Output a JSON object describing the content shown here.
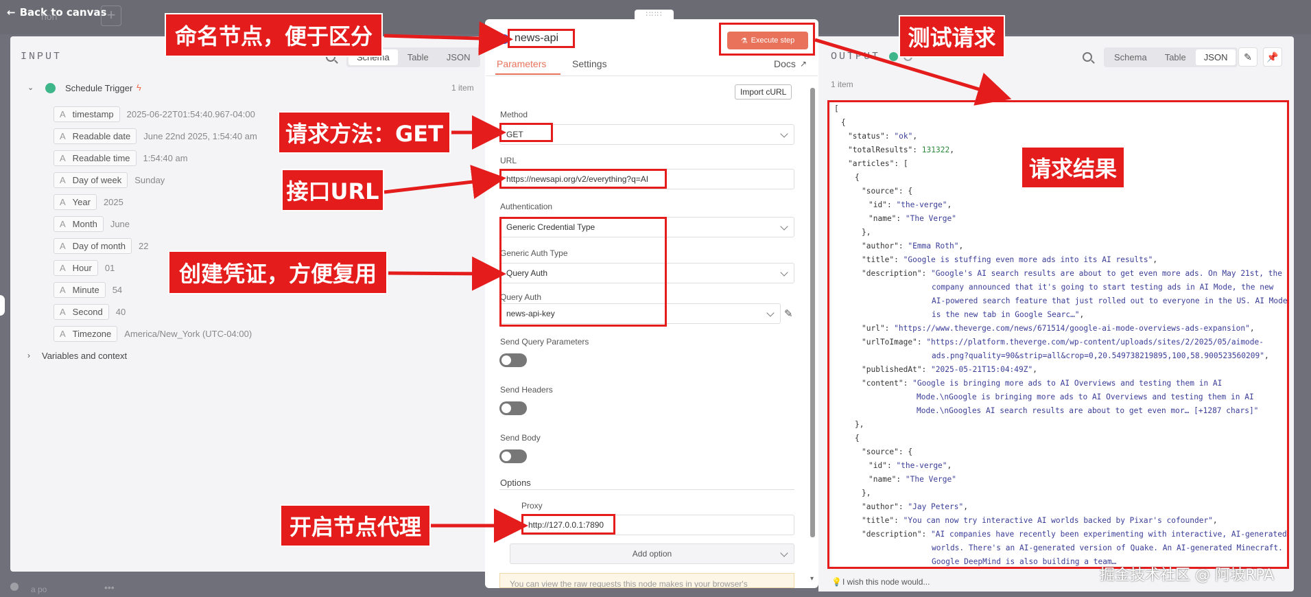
{
  "topbar": {
    "back_label": "Back to canvas",
    "ghost_name": "hon"
  },
  "input": {
    "title": "INPUT",
    "views": [
      "Schema",
      "Table",
      "JSON"
    ],
    "trigger": "Schedule Trigger",
    "count": "1 item",
    "fields": [
      {
        "key": "timestamp",
        "value": "2025-06-22T01:54:40.967-04:00"
      },
      {
        "key": "Readable date",
        "value": "June 22nd 2025, 1:54:40 am"
      },
      {
        "key": "Readable time",
        "value": "1:54:40 am"
      },
      {
        "key": "Day of week",
        "value": "Sunday"
      },
      {
        "key": "Year",
        "value": "2025"
      },
      {
        "key": "Month",
        "value": "June"
      },
      {
        "key": "Day of month",
        "value": "22"
      },
      {
        "key": "Hour",
        "value": "01"
      },
      {
        "key": "Minute",
        "value": "54"
      },
      {
        "key": "Second",
        "value": "40"
      },
      {
        "key": "Timezone",
        "value": "America/New_York (UTC-04:00)"
      }
    ],
    "variables": "Variables and context",
    "footer_node": "a po"
  },
  "node": {
    "name": "news-api",
    "execute": "Execute step",
    "tabs": [
      "Parameters",
      "Settings"
    ],
    "docs": "Docs",
    "import_curl": "Import cURL",
    "method_label": "Method",
    "method": "GET",
    "url_label": "URL",
    "url": "https://newsapi.org/v2/everything?q=AI",
    "auth_label": "Authentication",
    "auth": "Generic Credential Type",
    "gat_label": "Generic Auth Type",
    "gat": "Query Auth",
    "qa_label": "Query Auth",
    "qa": "news-api-key",
    "sqp": "Send Query Parameters",
    "sh": "Send Headers",
    "sb": "Send Body",
    "options": "Options",
    "proxy_label": "Proxy",
    "proxy": "http://127.0.0.1:7890",
    "add_option": "Add option",
    "note": "You can view the raw requests this node makes in your browser's"
  },
  "output": {
    "title": "OUTPUT",
    "views": [
      "Schema",
      "Table",
      "JSON"
    ],
    "count": "1 item",
    "wish": "I wish this node would..."
  },
  "annotations": {
    "a1": "命名节点，便于区分",
    "a2": "测试请求",
    "a3": "请求方法：GET",
    "a4": "接口URL",
    "a5": "创建凭证，方便复用",
    "a6": "开启节点代理",
    "a7": "请求结果"
  },
  "watermark": "掘金技术社区 @ 阿坡RPA",
  "colors": {
    "accent": "#e8735a",
    "annotation": "#e41c1c",
    "tab_active": "#e8735a"
  }
}
